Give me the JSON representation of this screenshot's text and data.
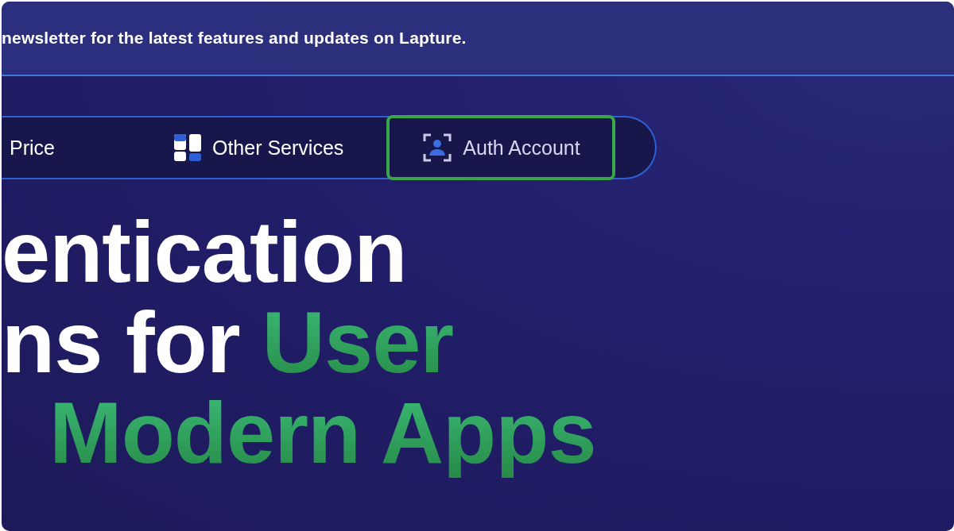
{
  "banner": {
    "text": "newsletter for the latest features and updates on Lapture."
  },
  "nav": {
    "items": [
      {
        "label": "Price",
        "kind": "plain",
        "selected": false
      },
      {
        "label": "Other Services",
        "kind": "grid",
        "selected": false
      },
      {
        "label": "Auth Account",
        "kind": "user",
        "selected": true
      }
    ]
  },
  "hero": {
    "lines": [
      [
        {
          "text": "entication",
          "accent": false
        }
      ],
      [
        {
          "text": "ns for",
          "accent": false
        },
        {
          "text": "User",
          "accent": true
        }
      ],
      [
        {
          "text": "Modern Apps",
          "accent": true
        }
      ]
    ]
  }
}
